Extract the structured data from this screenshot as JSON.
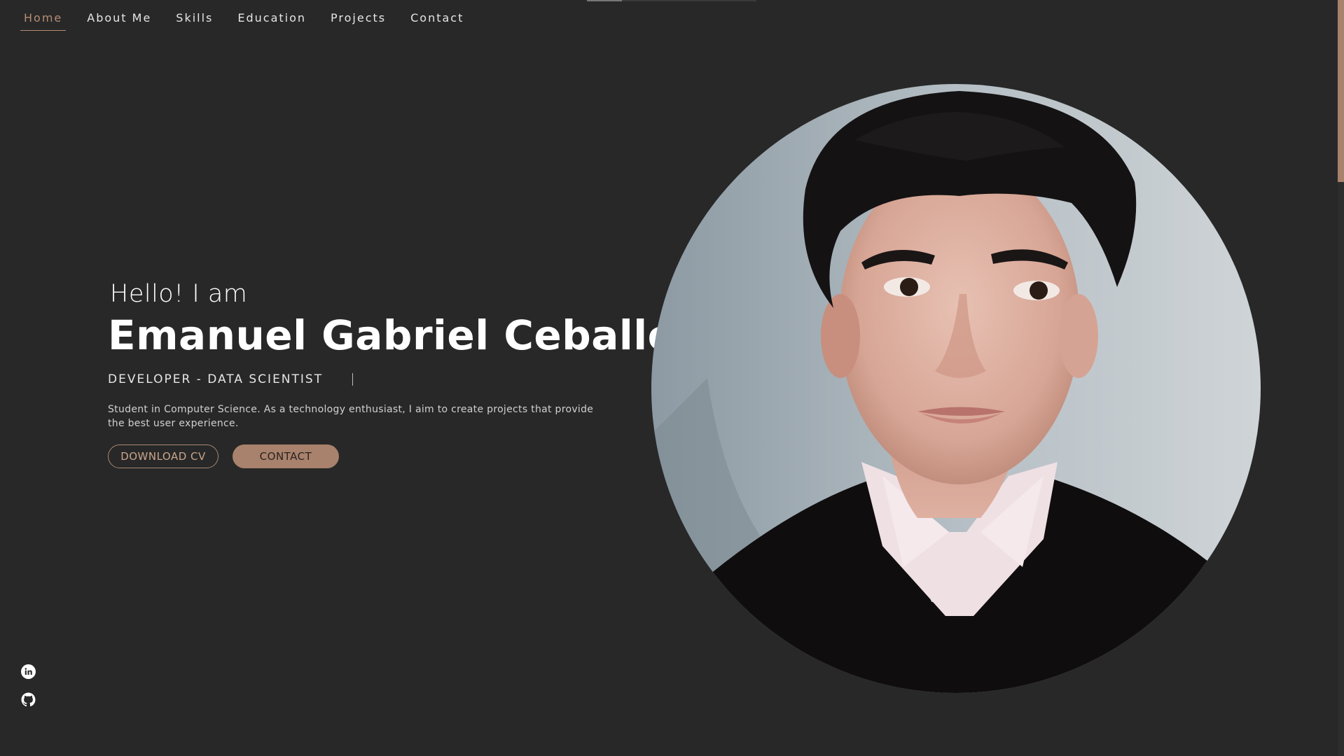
{
  "navbar": {
    "items": [
      {
        "label": "Home",
        "active": true
      },
      {
        "label": "About Me",
        "active": false
      },
      {
        "label": "Skills",
        "active": false
      },
      {
        "label": "Education",
        "active": false
      },
      {
        "label": "Projects",
        "active": false
      },
      {
        "label": "Contact",
        "active": false
      }
    ]
  },
  "hero": {
    "greeting": "Hello! I am",
    "name": "Emanuel Gabriel Ceballos",
    "role": "DEVELOPER - DATA SCIENTIST",
    "description": "Student in Computer Science. As a technology enthusiast, I aim to create projects that provide the best user experience.",
    "download_cv_label": "DOWNLOAD CV",
    "contact_label": "CONTACT"
  },
  "social": [
    {
      "icon": "linkedin-icon"
    },
    {
      "icon": "github-icon"
    }
  ],
  "colors": {
    "background": "#282828",
    "accent": "#a8826c",
    "text": "#ffffff"
  }
}
